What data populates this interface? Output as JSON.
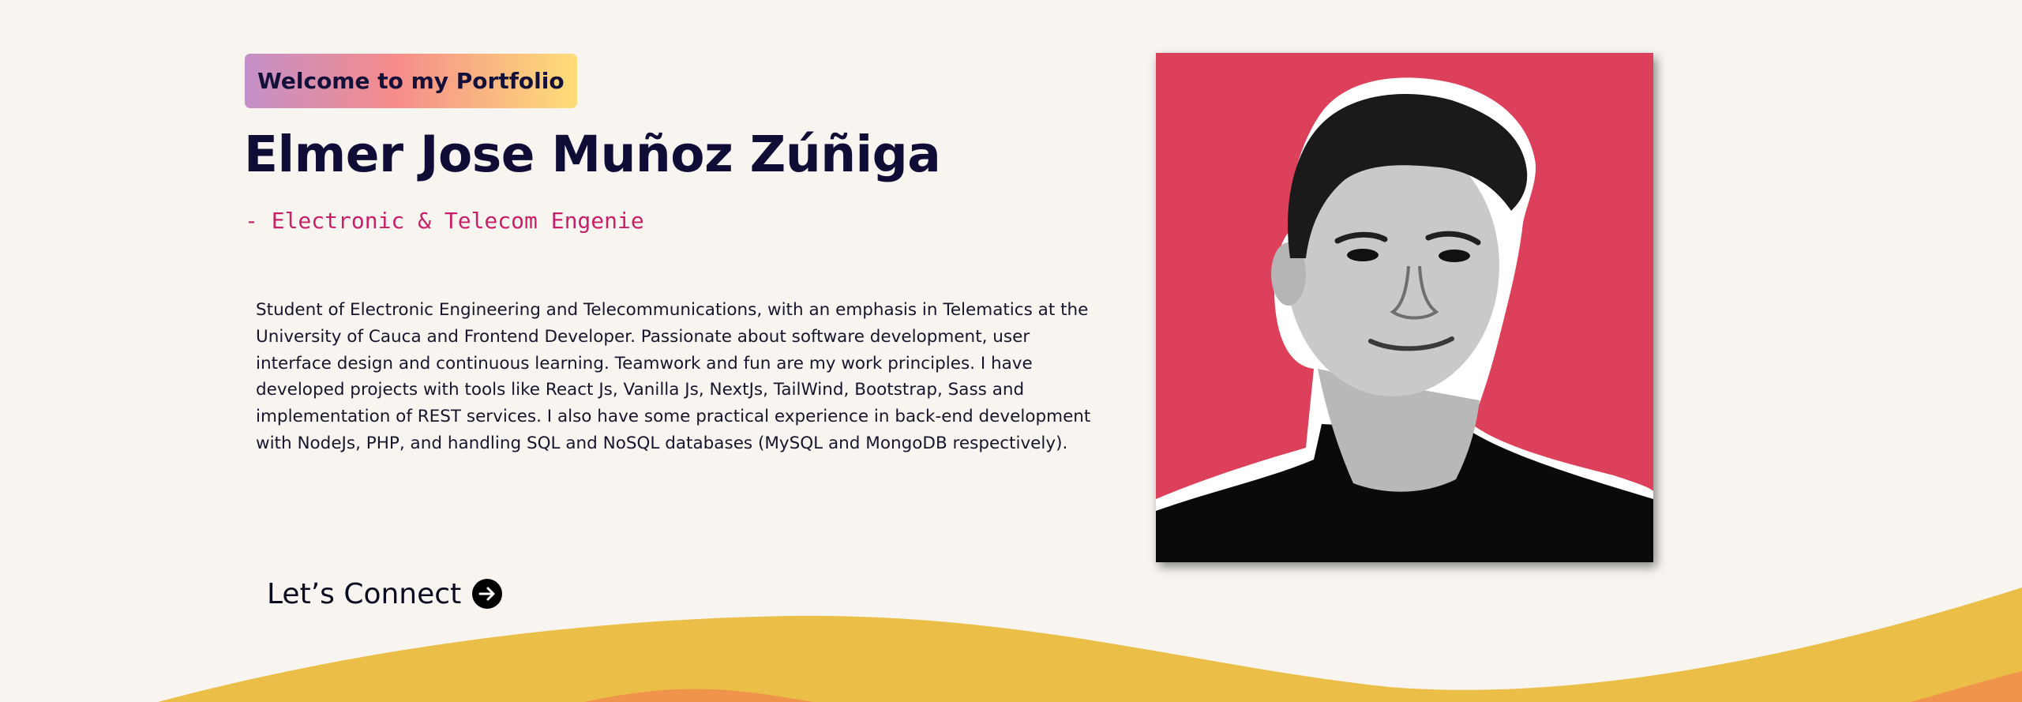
{
  "hero": {
    "badge_text": "Welcome to my Portfolio",
    "name": "Elmer Jose Muñoz Zúñiga",
    "role": "- Electronic & Telecom Engenie",
    "bio": "Student of Electronic Engineering and Telecommunications, with an emphasis in Telematics at the University of Cauca and Frontend Developer. Passionate about software development, user interface design and continuous learning. Teamwork and fun are my work principles. I have developed projects with tools like React Js, Vanilla Js, NextJs, TailWind, Bootstrap, Sass and implementation of REST services. I also have some practical experience in back-end development with NodeJs, PHP, and handling SQL and NoSQL databases (MySQL and MongoDB respectively).",
    "connect_label": "Let’s Connect",
    "connect_icon": "arrow-right-circle-icon"
  },
  "colors": {
    "background": "#f8f5f0",
    "name_text": "#0f0c36",
    "role_text": "#c91f68",
    "photo_background": "#dd405a",
    "wave_yellow": "#ebbf47",
    "wave_orange": "#f0934b"
  }
}
